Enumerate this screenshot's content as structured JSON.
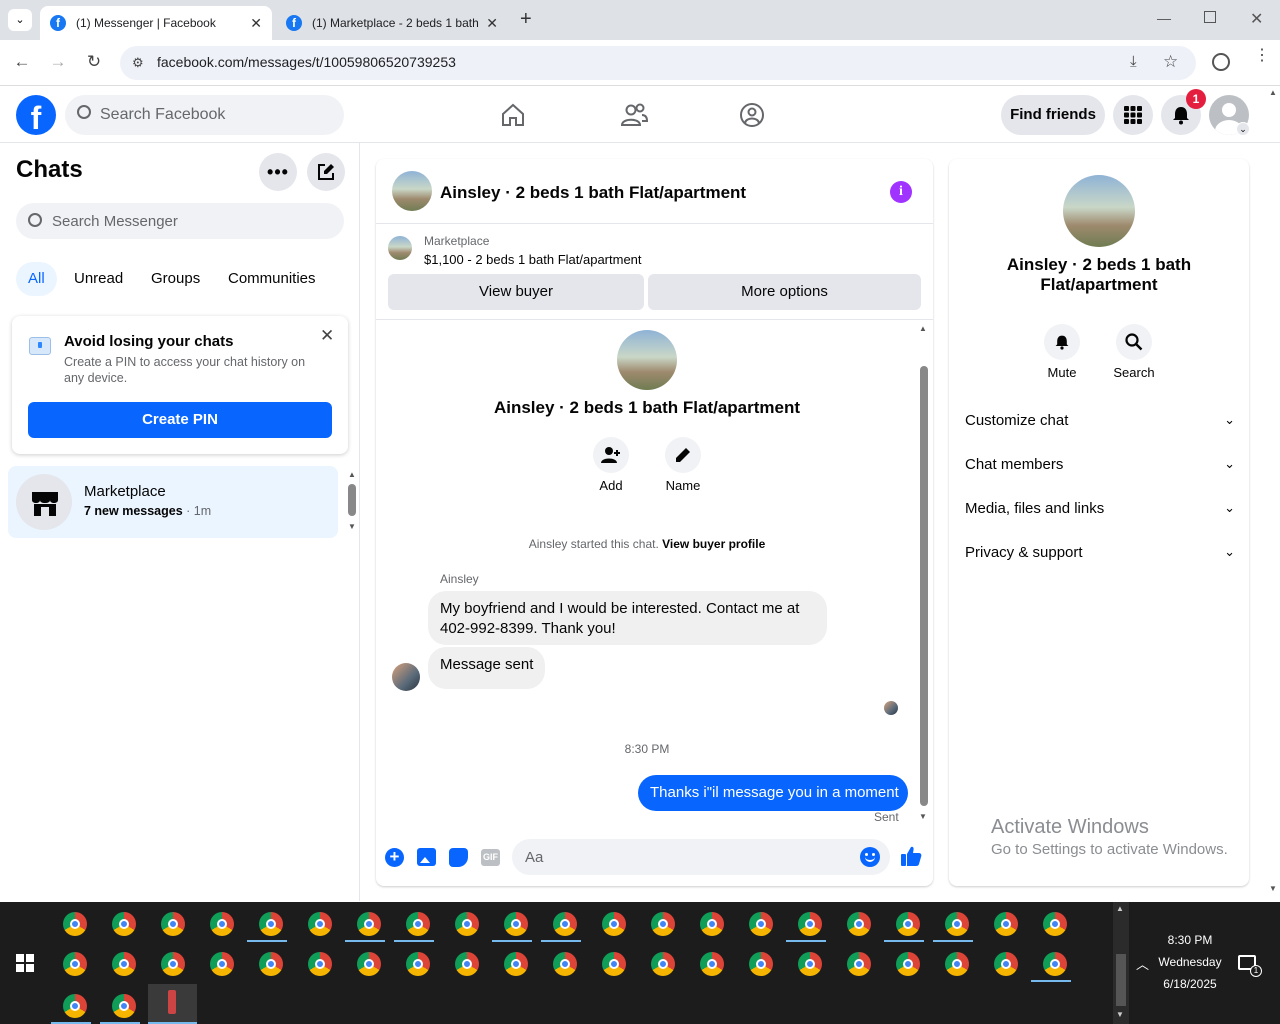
{
  "browser": {
    "tabs": [
      {
        "title": "(1) Messenger | Facebook",
        "active": true
      },
      {
        "title": "(1) Marketplace - 2 beds 1 bath",
        "active": false
      }
    ],
    "url": "facebook.com/messages/t/10059806520739253"
  },
  "fb": {
    "logo": "f",
    "search_placeholder": "Search Facebook",
    "find_friends": "Find friends",
    "notification_count": "1",
    "accent": "#0866ff"
  },
  "left": {
    "title": "Chats",
    "search_placeholder": "Search Messenger",
    "filters": [
      "All",
      "Unread",
      "Groups",
      "Communities"
    ],
    "pin_card": {
      "title": "Avoid losing your chats",
      "body": "Create a PIN to access your chat history on any device.",
      "button": "Create PIN"
    },
    "chat_item": {
      "name": "Marketplace",
      "preview": "7 new messages",
      "time": "· 1m"
    }
  },
  "chat": {
    "header_title": "Ainsley · 2 beds 1 bath Flat/apartment",
    "listing_label": "Marketplace",
    "listing_title": "$1,100 - 2 beds 1 bath Flat/apartment",
    "view_buyer": "View buyer",
    "more_options": "More options",
    "profile_name": "Ainsley · 2 beds 1 bath Flat/apartment",
    "add_label": "Add",
    "name_label": "Name",
    "started_text": "Ainsley started this chat.",
    "view_profile": "View buyer profile",
    "sender": "Ainsley",
    "msg1": "My boyfriend and I would be interested. Contact me at 402-992-8399. Thank you!",
    "msg2": "Message sent",
    "timestamp": "8:30 PM",
    "msg_out": "Thanks i\"il message you in a moment",
    "status": "Sent",
    "composer_placeholder": "Aa"
  },
  "right": {
    "title": "Ainsley · 2 beds 1 bath Flat/apartment",
    "mute": "Mute",
    "search": "Search",
    "sections": [
      "Customize chat",
      "Chat members",
      "Media, files and links",
      "Privacy & support"
    ]
  },
  "watermark": {
    "title": "Activate Windows",
    "sub": "Go to Settings to activate Windows."
  },
  "taskbar": {
    "time": "8:30 PM",
    "day": "Wednesday",
    "date": "6/18/2025",
    "notif_count": "1"
  }
}
